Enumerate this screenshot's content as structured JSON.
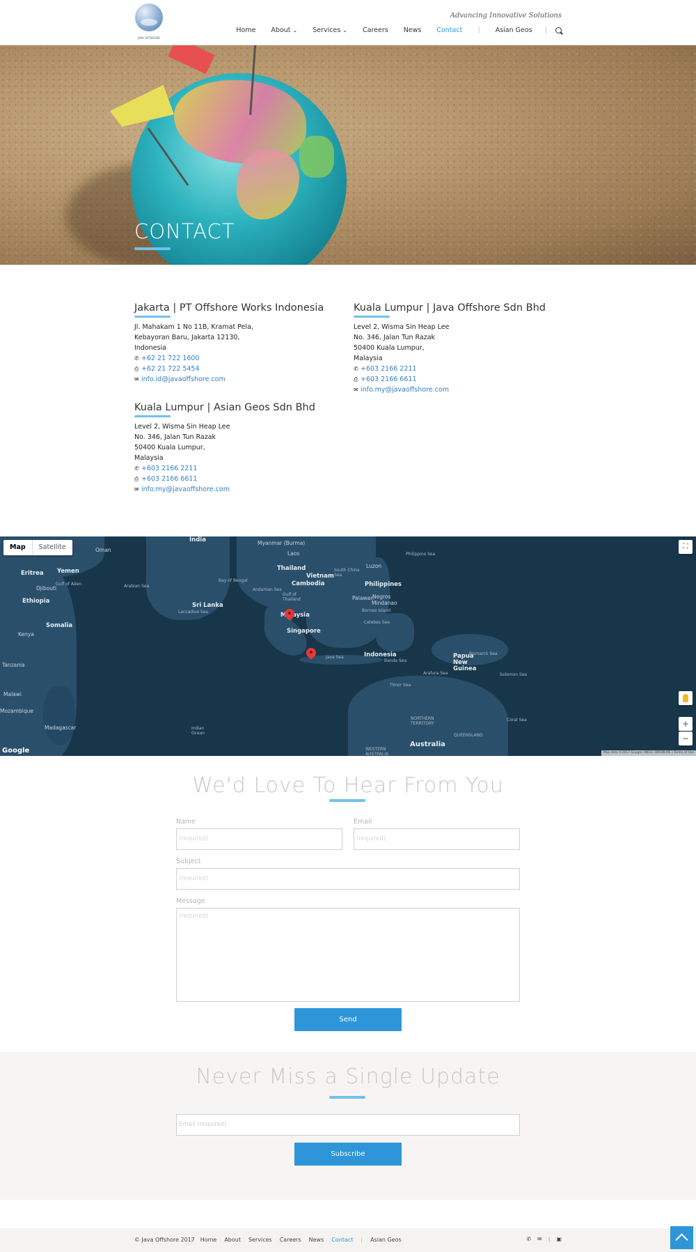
{
  "header": {
    "logo_text": "JAVA OFFSHORE",
    "tagline": "Advancing Innovative Solutions",
    "nav": [
      {
        "label": "Home",
        "has_dropdown": false,
        "active": false
      },
      {
        "label": "About",
        "has_dropdown": true,
        "active": false
      },
      {
        "label": "Services",
        "has_dropdown": true,
        "active": false
      },
      {
        "label": "Careers",
        "has_dropdown": false,
        "active": false
      },
      {
        "label": "News",
        "has_dropdown": false,
        "active": false
      },
      {
        "label": "Contact",
        "has_dropdown": false,
        "active": true
      }
    ],
    "nav_extra": "Asian Geos",
    "search_icon": "search-icon"
  },
  "hero": {
    "title": "CONTACT"
  },
  "offices": [
    {
      "title": "Jakarta | PT Offshore Works Indonesia",
      "address": [
        "Jl. Mahakam 1 No 11B, Kramat Pela,",
        "Kebayoran Baru, Jakarta 12130,",
        "Indonesia"
      ],
      "phone": "+62 21 722 1600",
      "fax": "+62 21 722 5454",
      "email": "info.id@javaoffshore.com"
    },
    {
      "title": "Kuala Lumpur | Java Offshore Sdn Bhd",
      "address": [
        "Level 2, Wisma Sin Heap Lee",
        "No. 346, Jalan Tun Razak",
        "50400 Kuala Lumpur,",
        "Malaysia"
      ],
      "phone": "+603 2166 2211",
      "fax": "+603 2166 6611",
      "email": "info.my@javaoffshore.com"
    },
    {
      "title": "Kuala Lumpur | Asian Geos Sdn Bhd",
      "address": [
        "Level 2, Wisma Sin Heap Lee",
        "No. 346, Jalan Tun Razak",
        "50400 Kuala Lumpur,",
        "Malaysia"
      ],
      "phone": "+603 2166 2211",
      "fax": "+603 2166 6611",
      "email": "info.my@javaoffshore.com"
    }
  ],
  "map": {
    "type_options": [
      "Map",
      "Satellite"
    ],
    "selected_type": "Map",
    "google_label": "Google",
    "attribution": "Map data ©2017 Google, INEGI, ORION-ME | Terms of Use",
    "zoom_in": "+",
    "zoom_out": "−",
    "labels": {
      "india": "India",
      "myanmar": "Myanmar (Burma)",
      "laos": "Laos",
      "thailand": "Thailand",
      "vietnam": "Vietnam",
      "cambodia": "Cambodia",
      "philippines": "Philippines",
      "malaysia": "Malaysia",
      "singapore": "Singapore",
      "indonesia": "Indonesia",
      "png": "Papua New Guinea",
      "australia": "Australia",
      "srilanka": "Sri Lanka",
      "yemen": "Yemen",
      "oman": "Oman",
      "eritrea": "Eritrea",
      "djibouti": "Djibouti",
      "ethiopia": "Ethiopia",
      "somalia": "Somalia",
      "kenya": "Kenya",
      "tanzania": "Tanzania",
      "malawi": "Malawi",
      "mozambique": "Mozambique",
      "madagascar": "Madagascar",
      "luzon": "Luzon",
      "palawan": "Palawan",
      "negros": "Negros",
      "mindanao": "Mindanao",
      "borneo": "Borneo Island",
      "bay_bengal": "Bay of Bengal",
      "andaman": "Andaman Sea",
      "gulf_thailand": "Gulf of Thailand",
      "scs": "South China Sea",
      "philippine_sea": "Philippine Sea",
      "celebes": "Celebes Sea",
      "java_sea": "Java Sea",
      "banda": "Banda Sea",
      "arafura": "Arafura Sea",
      "timor": "Timor Sea",
      "bismarck": "Bismarck Sea",
      "solomon": "Solomon Sea",
      "coral": "Coral Sea",
      "arabian": "Arabian Sea",
      "laccadive": "Laccadive Sea",
      "gulf_aden": "Gulf of Aden",
      "indian_ocean": "Indian Ocean",
      "nt": "NORTHERN TERRITORY",
      "qld": "QUEENSLAND",
      "wa": "WESTERN AUSTRALIA"
    }
  },
  "contact_form": {
    "title": "We'd Love To Hear From You",
    "name_label": "Name",
    "email_label": "Email",
    "subject_label": "Subject",
    "message_label": "Message",
    "placeholder": "(required)",
    "send_label": "Send"
  },
  "subscribe": {
    "title": "Never Miss a Single Update",
    "placeholder": "Email (required)",
    "button_label": "Subscribe"
  },
  "footer": {
    "copyright": "© Java Offshore 2017",
    "nav": [
      "Home",
      "About",
      "Services",
      "Careers",
      "News",
      "Contact"
    ],
    "active": "Contact",
    "extra": "Asian Geos"
  },
  "colors": {
    "accent": "#2e96d8",
    "underline": "#72c0ea",
    "map_water": "#18364a",
    "map_land": "#2a4f6a"
  }
}
